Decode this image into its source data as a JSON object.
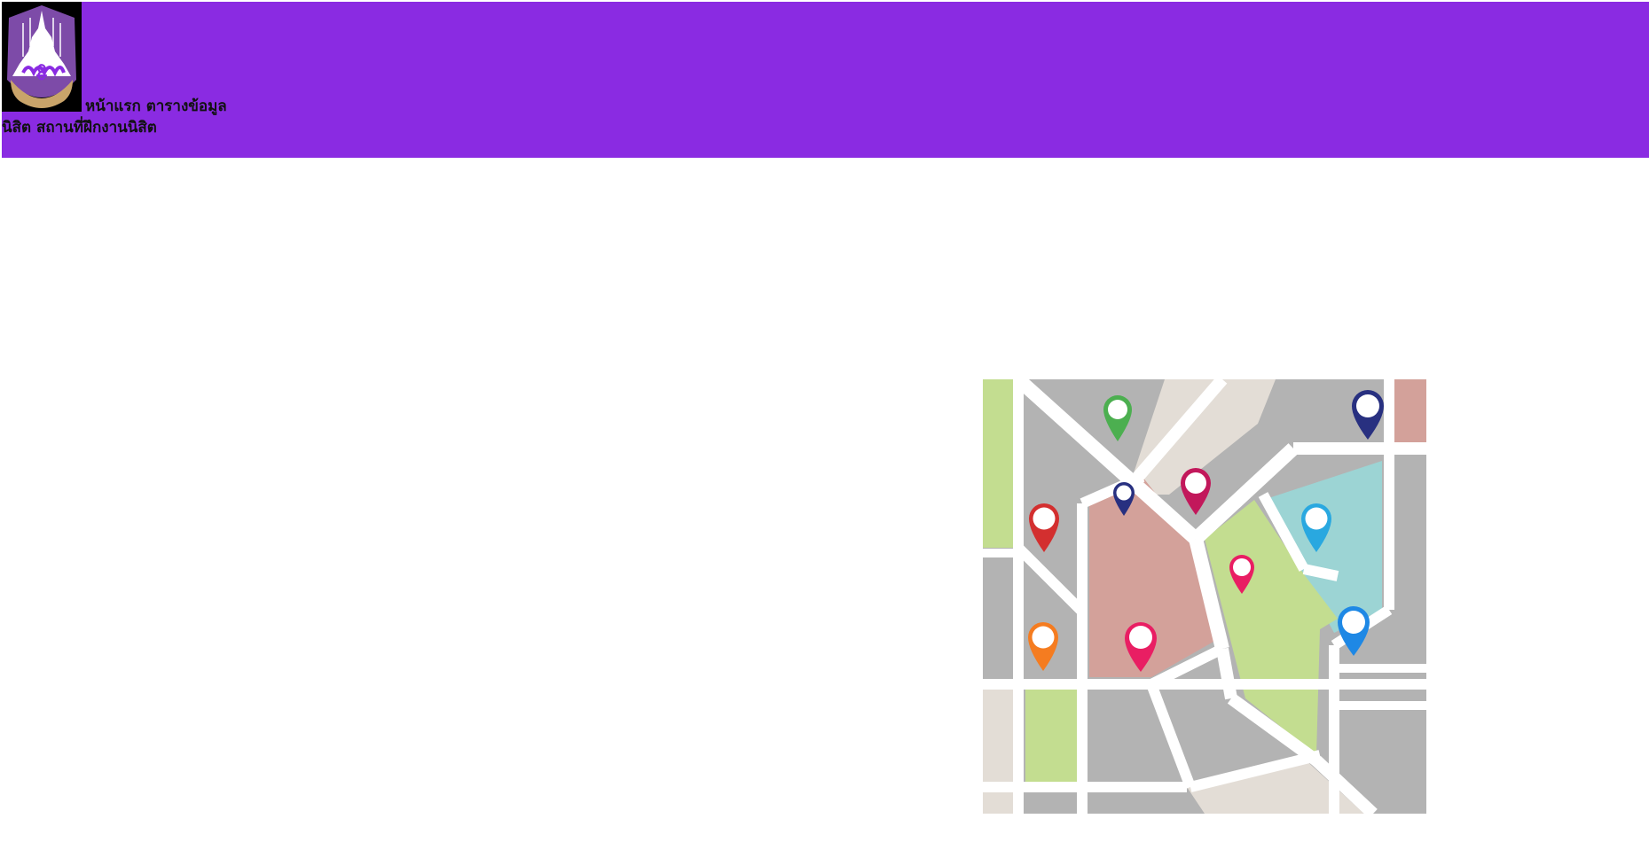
{
  "header": {
    "background_color": "#8a2be2",
    "logo_icon": "university-seal-logo",
    "nav": {
      "home_label": "หน้าแรก",
      "student_table_label": "ตารางข้อมูลนิสิต",
      "training_site_label": "สถานที่ฝึกงานนิสิต"
    }
  },
  "main": {
    "illustration_icon": "city-map-with-pins-illustration",
    "pin_colors": [
      "#4caf50",
      "#283080",
      "#c2185b",
      "#d32f2f",
      "#29a8e0",
      "#e91e63",
      "#f57c20",
      "#1e88e5"
    ]
  }
}
